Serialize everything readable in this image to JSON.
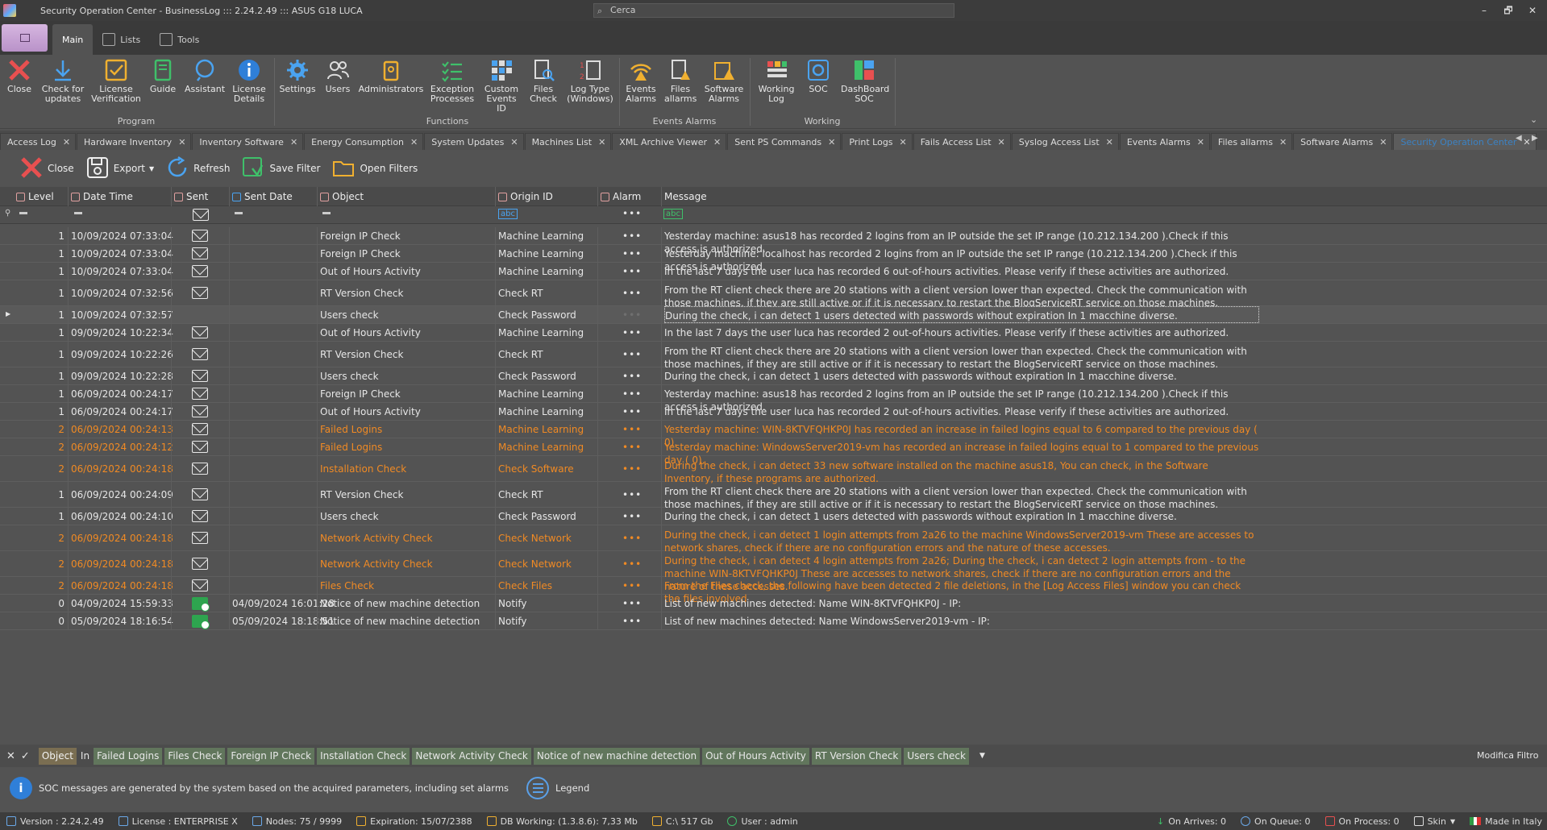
{
  "window": {
    "title": "Security Operation Center - BusinessLog ::: 2.24.2.49 ::: ASUS G18 LUCA",
    "search_placeholder": "Cerca",
    "controls": [
      "–",
      "🗗",
      "✕"
    ]
  },
  "ribbon_tabs": [
    "Main",
    "Lists",
    "Tools"
  ],
  "ribbon": {
    "groups": [
      {
        "label": "Program",
        "buttons": [
          "Close",
          "Check for updates",
          "License Verification",
          "Guide",
          "Assistant",
          "License Details"
        ]
      },
      {
        "label": "Functions",
        "buttons": [
          "Settings",
          "Users",
          "Administrators",
          "Exception Processes",
          "Custom Events ID",
          "Files Check",
          "Log Type (Windows)"
        ]
      },
      {
        "label": "Events Alarms",
        "buttons": [
          "Events Alarms",
          "Files allarms",
          "Software Alarms"
        ]
      },
      {
        "label": "Working",
        "buttons": [
          "Working Log",
          "SOC",
          "DashBoard SOC"
        ]
      }
    ]
  },
  "doc_tabs": [
    "Access Log",
    "Hardware Inventory",
    "Inventory Software",
    "Energy Consumption",
    "System Updates",
    "Machines List",
    "XML Archive Viewer",
    "Sent PS Commands",
    "Print Logs",
    "Fails Access List",
    "Syslog Access List",
    "Events Alarms",
    "Files allarms",
    "Software Alarms",
    "Security Operation Center"
  ],
  "toolbar": {
    "close": "Close",
    "export": "Export",
    "refresh": "Refresh",
    "save_filter": "Save Filter",
    "open_filters": "Open Filters"
  },
  "grid": {
    "columns": [
      "Level",
      "Date Time",
      "Sent",
      "Sent Date",
      "Object",
      "Origin ID",
      "Alarm",
      "Message"
    ],
    "filter_tokens": [
      "abc",
      "abc"
    ],
    "rows": [
      {
        "level": "1",
        "datetime": "10/09/2024 07:33:04",
        "sent_date": "",
        "object": "Foreign IP Check",
        "origin": "Machine Learning",
        "alarm": "•••",
        "message": "Yesterday machine: asus18 has recorded 2 logins from an IP outside the set IP range (10.212.134.200 ).Check if this access is authorized."
      },
      {
        "level": "1",
        "datetime": "10/09/2024 07:33:04",
        "sent_date": "",
        "object": "Foreign IP Check",
        "origin": "Machine Learning",
        "alarm": "•••",
        "message": "Yesterday machine: localhost has recorded 2 logins from an IP outside the set IP range (10.212.134.200 ).Check if this access is authorized."
      },
      {
        "level": "1",
        "datetime": "10/09/2024 07:33:04",
        "sent_date": "",
        "object": "Out of Hours Activity",
        "origin": "Machine Learning",
        "alarm": "•••",
        "message": "In the last 7 days the user luca has recorded 6 out-of-hours activities. Please verify if these activities are authorized."
      },
      {
        "level": "1",
        "datetime": "10/09/2024 07:32:56",
        "sent_date": "",
        "object": "RT Version Check",
        "origin": "Check RT",
        "alarm": "•••",
        "message": "From the RT client check there are 20 stations with a client version lower than expected. Check the communication with those machines, if they are still active or if it is necessary to restart the BlogServiceRT service on those machines."
      },
      {
        "level": "1",
        "datetime": "10/09/2024 07:32:57",
        "sent_date": "",
        "object": "Users check",
        "origin": "Check Password",
        "alarm": "•••",
        "message": "During the check, i can detect 1 users detected with passwords without expiration  In 1 macchine diverse."
      },
      {
        "level": "1",
        "datetime": "09/09/2024 10:22:34",
        "sent_date": "",
        "object": "Out of Hours Activity",
        "origin": "Machine Learning",
        "alarm": "•••",
        "message": "In the last 7 days the user luca has recorded 2 out-of-hours activities. Please verify if these activities are authorized."
      },
      {
        "level": "1",
        "datetime": "09/09/2024 10:22:26",
        "sent_date": "",
        "object": "RT Version Check",
        "origin": "Check RT",
        "alarm": "•••",
        "message": "From the RT client check there are 20 stations with a client version lower than expected. Check the communication with those machines, if they are still active or if it is necessary to restart the BlogServiceRT service on those machines."
      },
      {
        "level": "1",
        "datetime": "09/09/2024 10:22:28",
        "sent_date": "",
        "object": "Users check",
        "origin": "Check Password",
        "alarm": "•••",
        "message": "During the check, i can detect 1 users detected with passwords without expiration  In 1 macchine diverse."
      },
      {
        "level": "1",
        "datetime": "06/09/2024 00:24:17",
        "sent_date": "",
        "object": "Foreign IP Check",
        "origin": "Machine Learning",
        "alarm": "•••",
        "message": "Yesterday machine: asus18 has recorded 2 logins from an IP outside the set IP range (10.212.134.200 ).Check if this access is authorized."
      },
      {
        "level": "1",
        "datetime": "06/09/2024 00:24:17",
        "sent_date": "",
        "object": "Out of Hours Activity",
        "origin": "Machine Learning",
        "alarm": "•••",
        "message": "In the last 7 days the user luca has recorded 2 out-of-hours activities. Please verify if these activities are authorized."
      },
      {
        "level": "2",
        "datetime": "06/09/2024 00:24:13",
        "sent_date": "",
        "object": "Failed Logins",
        "origin": "Machine Learning",
        "alarm": "•••",
        "message": "Yesterday machine: WIN-8KTVFQHKP0J has recorded an increase in failed logins equal to 6 compared to the previous day ( 0)."
      },
      {
        "level": "2",
        "datetime": "06/09/2024 00:24:12",
        "sent_date": "",
        "object": "Failed Logins",
        "origin": "Machine Learning",
        "alarm": "•••",
        "message": "Yesterday machine: WindowsServer2019-vm has recorded an increase in failed logins equal to 1 compared to the previous day ( 0)."
      },
      {
        "level": "2",
        "datetime": "06/09/2024 00:24:18",
        "sent_date": "",
        "object": "Installation Check",
        "origin": "Check Software",
        "alarm": "•••",
        "message": "During the check, i can detect  33  new software installed on the machine  asus18,  You can check, in the Software Inventory, if these programs are authorized."
      },
      {
        "level": "1",
        "datetime": "06/09/2024 00:24:09",
        "sent_date": "",
        "object": "RT Version Check",
        "origin": "Check RT",
        "alarm": "•••",
        "message": "From the RT client check there are 20 stations with a client version lower than expected. Check the communication with those machines, if they are still active or if it is necessary to restart the BlogServiceRT service on those machines."
      },
      {
        "level": "1",
        "datetime": "06/09/2024 00:24:10",
        "sent_date": "",
        "object": "Users check",
        "origin": "Check Password",
        "alarm": "•••",
        "message": "During the check, i can detect 1 users detected with passwords without expiration  In 1 macchine diverse."
      },
      {
        "level": "2",
        "datetime": "06/09/2024 00:24:18",
        "sent_date": "",
        "object": "Network Activity Check",
        "origin": "Check Network",
        "alarm": "•••",
        "message": "During the check, i can detect 1 login attempts from 2a26 to the machine WindowsServer2019-vm These are accesses to network shares, check if there are no configuration errors and the nature of these accesses."
      },
      {
        "level": "2",
        "datetime": "06/09/2024 00:24:18",
        "sent_date": "",
        "object": "Network Activity Check",
        "origin": "Check Network",
        "alarm": "•••",
        "message": "During the check, i can detect 4 login attempts from 2a26; During the check, i can detect 2 login attempts from - to the machine WIN-8KTVFQHKP0J These are accesses to network shares, check if there are no configuration errors and the nature of these accesses."
      },
      {
        "level": "2",
        "datetime": "06/09/2024 00:24:18",
        "sent_date": "",
        "object": "Files Check",
        "origin": "Check Files",
        "alarm": "•••",
        "message": "From the Files check, the following have been detected 2 file deletions, in the [Log Access Files] window you can check the files involved"
      },
      {
        "level": "0",
        "datetime": "04/09/2024 15:59:33",
        "sent_date": "04/09/2024 16:01:28",
        "object": "Notice of new machine detection",
        "origin": "Notify",
        "alarm": "•••",
        "message": " List of new machines detected: Name WIN-8KTVFQHKP0J - IP:"
      },
      {
        "level": "0",
        "datetime": "05/09/2024 18:16:54",
        "sent_date": "05/09/2024 18:18:51",
        "object": "Notice of new machine detection",
        "origin": "Notify",
        "alarm": "•••",
        "message": " List of new machines detected: Name WindowsServer2019-vm - IP:"
      }
    ]
  },
  "filter_bar": {
    "field": "Object",
    "operator": "In",
    "values": [
      "Failed Logins",
      "Files Check",
      "Foreign IP Check",
      "Installation Check",
      "Network Activity Check",
      "Notice of new machine detection",
      "Out of Hours Activity",
      "RT Version Check",
      "Users check"
    ],
    "edit_filter": "Modifica Filtro"
  },
  "info": {
    "text": "SOC messages are generated by the system based on the acquired parameters, including set alarms",
    "legend": "Legend"
  },
  "status": {
    "version": "Version : 2.24.2.49",
    "license": "License : ENTERPRISE X",
    "nodes": "Nodes: 75 / 9999",
    "expiration": "Expiration: 15/07/2388",
    "db": "DB Working: (1.3.8.6): 7,33 Mb",
    "disk": "C:\\ 517 Gb",
    "user": "User : admin",
    "on_arrives": "On Arrives: 0",
    "on_queue": "On Queue: 0",
    "on_process": "On Process: 0",
    "skin": "Skin",
    "made_in": "Made in Italy"
  },
  "colors": {
    "accent": "#3b82c4",
    "warning": "#f08a24",
    "background": "#535353"
  }
}
